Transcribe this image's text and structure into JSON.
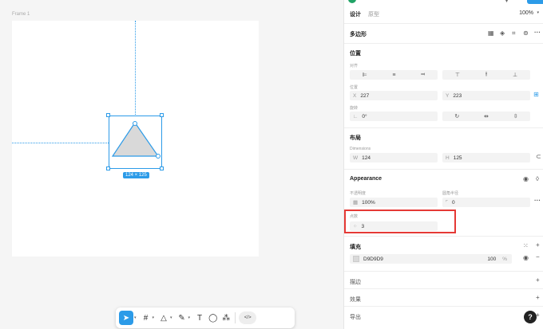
{
  "canvas": {
    "frame_label": "Frame 1",
    "dimension_badge": "124 × 125"
  },
  "toolbar": {
    "tools": [
      {
        "name": "move-tool",
        "icon": "cursor-icon",
        "glyph": "➤"
      },
      {
        "name": "frame-tool",
        "icon": "hash-icon",
        "glyph": "#"
      },
      {
        "name": "shape-tool",
        "icon": "triangle-icon",
        "glyph": "△"
      },
      {
        "name": "pen-tool",
        "icon": "pen-icon",
        "glyph": "✎"
      },
      {
        "name": "text-tool",
        "icon": "text-icon",
        "glyph": "T"
      },
      {
        "name": "comment-tool",
        "icon": "comment-icon",
        "glyph": "◯"
      },
      {
        "name": "components-tool",
        "icon": "components-icon",
        "glyph": "⁂"
      }
    ],
    "code_label": "</>"
  },
  "panel": {
    "tab_design": "设计",
    "tab_prototype": "原型",
    "zoom": "100%",
    "shape_title": "多边形",
    "position": {
      "title": "位置",
      "align_label": "对齐",
      "pos_label": "位置",
      "x_prefix": "X",
      "x_value": "227",
      "y_prefix": "Y",
      "y_value": "223",
      "rotation_label": "旋转",
      "rotation_value": "0°"
    },
    "layout": {
      "title": "布局",
      "dims_label": "Dimensions",
      "w_prefix": "W",
      "w_value": "124",
      "h_prefix": "H",
      "h_value": "125"
    },
    "appearance": {
      "title": "Appearance",
      "opacity_label": "不透明度",
      "opacity_value": "100%",
      "radius_label": "圆角半径",
      "radius_value": "0",
      "count_label": "点数",
      "count_value": "3"
    },
    "fill": {
      "title": "填充",
      "hex": "D9D9D9",
      "percent": "100",
      "percent_unit": "%",
      "swatch": "#d9d9d9"
    },
    "stroke_title": "描边",
    "effects_title": "效果",
    "export_title": "导出",
    "help": "?"
  },
  "colors": {
    "accent": "#2c9be8",
    "highlight": "#e53935"
  }
}
